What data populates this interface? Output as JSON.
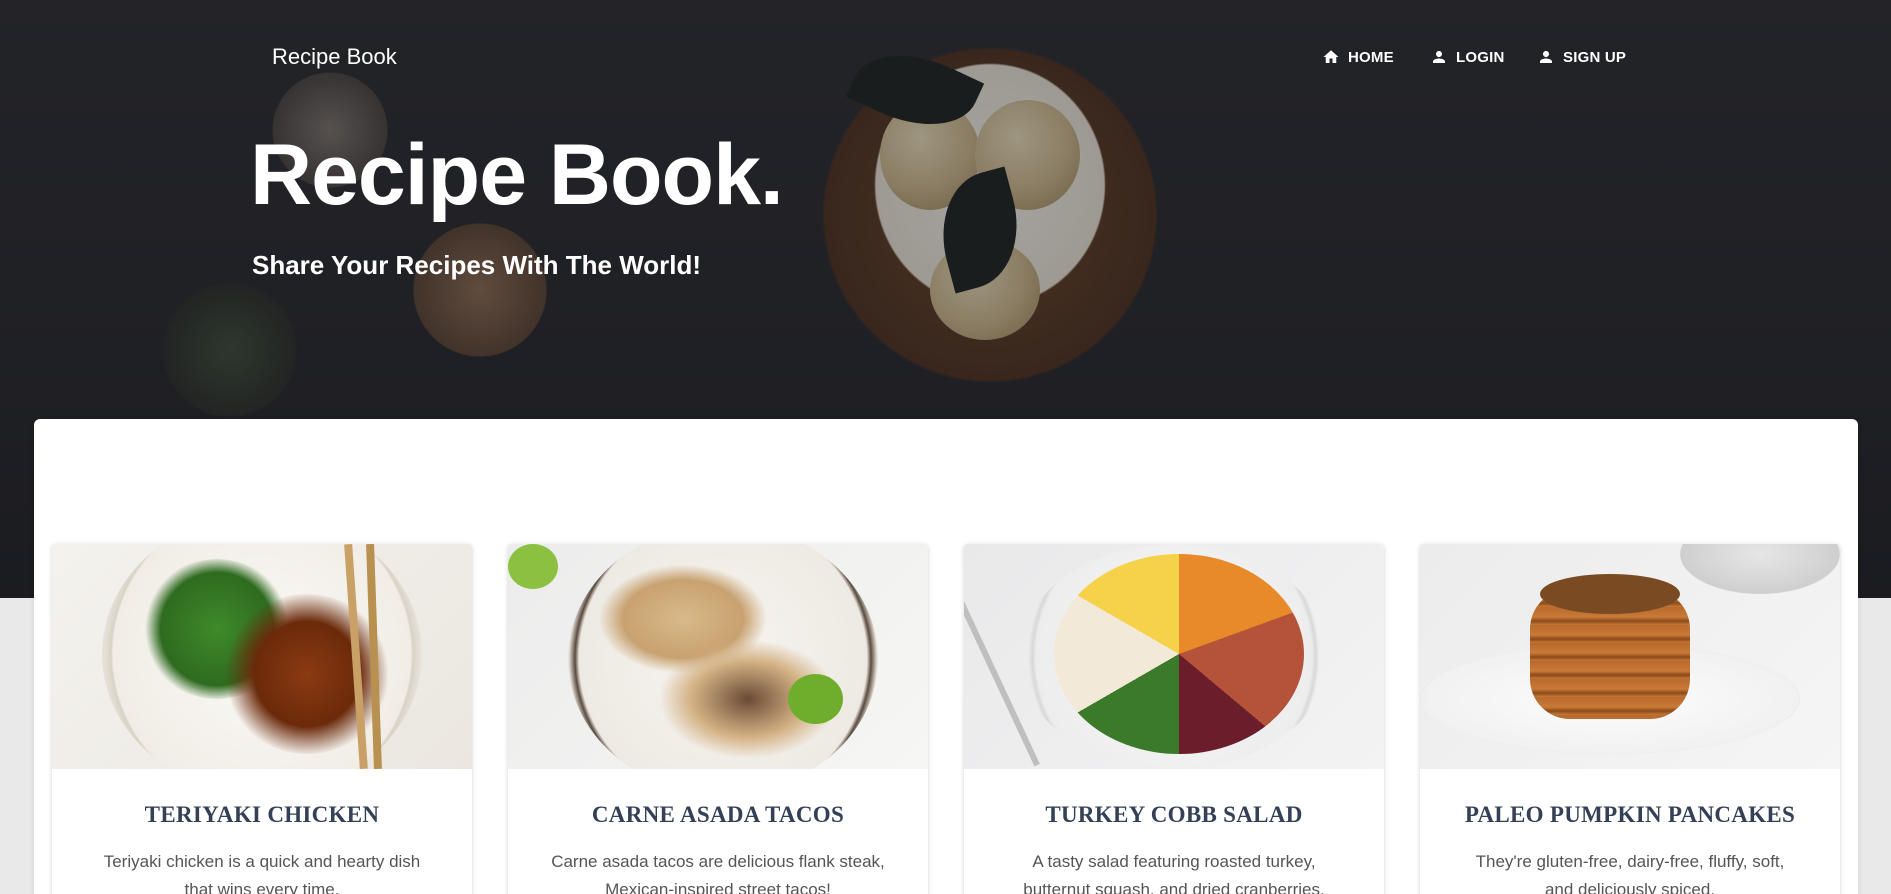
{
  "header": {
    "brand": "Recipe Book",
    "nav": [
      {
        "label": "HOME",
        "icon": "home-icon"
      },
      {
        "label": "LOGIN",
        "icon": "person-icon"
      },
      {
        "label": "SIGN UP",
        "icon": "person-icon"
      }
    ]
  },
  "hero": {
    "title": "Recipe Book.",
    "subtitle": "Share Your Recipes With The World!"
  },
  "recipes": [
    {
      "title": "TERIYAKI CHICKEN",
      "description": "Teriyaki chicken is a quick and hearty dish that wins every time."
    },
    {
      "title": "CARNE ASADA TACOS",
      "description": "Carne asada tacos are delicious flank steak, Mexican-inspired street tacos!"
    },
    {
      "title": "TURKEY COBB SALAD",
      "description": "A tasty salad featuring roasted turkey, butternut squash, and dried cranberries."
    },
    {
      "title": "PALEO PUMPKIN PANCAKES",
      "description": "They're gluten-free, dairy-free, fluffy, soft, and deliciously spiced."
    }
  ],
  "colors": {
    "card_title": "#344055",
    "hero_bg": "#26272b"
  }
}
